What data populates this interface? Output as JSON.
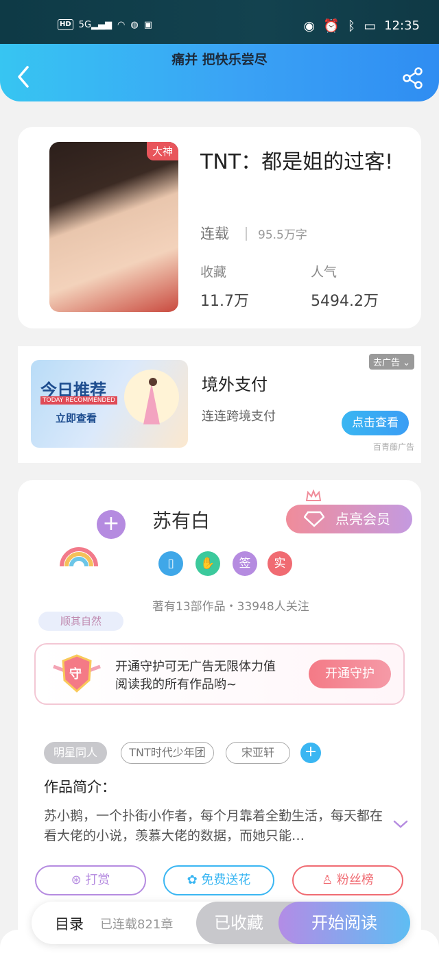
{
  "status_bar": {
    "hd": "HD",
    "signal": "5G",
    "time": "12:35"
  },
  "header": {
    "title": "痛并 把快乐尝尽"
  },
  "book": {
    "cover_tag": "大神",
    "title": "TNT：都是姐的过客!",
    "status": "连载",
    "word_count": "95.5万字",
    "stats": [
      {
        "label": "收藏",
        "value": "11.7万"
      },
      {
        "label": "人气",
        "value": "5494.2万"
      }
    ]
  },
  "ad": {
    "image_title": "今日推荐",
    "image_sub": "TODAY RECOMMENDED",
    "image_cta": "立即查看",
    "title": "境外支付",
    "subtitle": "连连跨境支付",
    "close_label": "去广告",
    "button": "点击查看",
    "source": "百青藤广告"
  },
  "author": {
    "name": "苏有白",
    "vip_button": "点亮会员",
    "badges": [
      {
        "icon": "phone-medal-icon",
        "text": "",
        "color": "#3fa7e8"
      },
      {
        "icon": "handshake-medal-icon",
        "text": "",
        "color": "#3cc99c"
      },
      {
        "icon": "sign-badge-icon",
        "text": "签",
        "color": "#b58be0"
      },
      {
        "icon": "real-name-badge-icon",
        "text": "实",
        "color": "#f06b72"
      }
    ],
    "info": "著有13部作品・33948人关注",
    "motto": "顺其自然",
    "guard_text_1": "开通守护可无广告无限体力值",
    "guard_text_2": "阅读我的所有作品哟~",
    "guard_icon_text": "守",
    "guard_button": "开通守护"
  },
  "tags": [
    "明星同人",
    "TNT时代少年团",
    "宋亚轩"
  ],
  "intro": {
    "heading": "作品简介：",
    "text": "苏小鹅，一个扑街小作者，每个月靠着全勤生活，每天都在看大佬的小说，羡慕大佬的数据，而她只能…"
  },
  "actions": [
    {
      "label": "打赏",
      "icon": "coin-icon",
      "color": "#b58be0"
    },
    {
      "label": "免费送花",
      "icon": "flower-icon",
      "color": "#3ab6f2"
    },
    {
      "label": "粉丝榜",
      "icon": "fans-icon",
      "color": "#f06b72"
    }
  ],
  "bottom": {
    "catalog": "目录",
    "chapters": "已连载821章",
    "collected": "已收藏",
    "start": "开始阅读"
  }
}
